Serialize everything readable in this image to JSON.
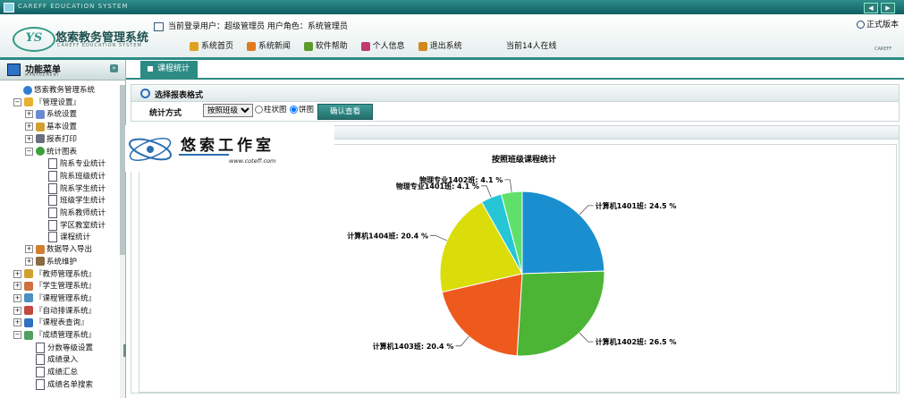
{
  "window": {
    "title": "CAREFF EDUCATION SYSTEM"
  },
  "header": {
    "logo_mark": "YS",
    "app_name": "悠索教务管理系统",
    "app_name_en": "CAREFF EDUCATION SYSTEM",
    "current_user_text": "当前登录用户：超级管理员 用户角色：系统管理员",
    "nav": [
      {
        "label": "系统首页",
        "color": "#e0a020"
      },
      {
        "label": "系统新闻",
        "color": "#e07a20"
      },
      {
        "label": "软件帮助",
        "color": "#5c9a2c"
      },
      {
        "label": "个人信息",
        "color": "#c03a70"
      },
      {
        "label": "退出系统",
        "color": "#d08a20"
      }
    ],
    "online_text": "当前14人在线",
    "version": "正式版本",
    "brand_small": "CAREFF"
  },
  "sidebar": {
    "title": "功能菜单",
    "subtitle": "MANAGEMENT",
    "tree": [
      {
        "label": "悠索教务管理系统",
        "level": 0,
        "pm": "",
        "icon": "globe-icon",
        "color": "#2f7fd0"
      },
      {
        "label": "『管理设置』",
        "level": 1,
        "pm": "−",
        "icon": "folder-icon",
        "color": "#e8b030"
      },
      {
        "label": "系统设置",
        "level": 2,
        "pm": "+",
        "icon": "settings-icon",
        "color": "#6a8ad0"
      },
      {
        "label": "基本设置",
        "level": 2,
        "pm": "+",
        "icon": "key-icon",
        "color": "#d0a030"
      },
      {
        "label": "报表打印",
        "level": 2,
        "pm": "+",
        "icon": "printer-icon",
        "color": "#6a7080"
      },
      {
        "label": "统计图表",
        "level": 2,
        "pm": "−",
        "icon": "pie-chart-icon",
        "color": "#3aa03a"
      },
      {
        "label": "院系专业统计",
        "level": 3,
        "pm": "",
        "icon": "document-icon",
        "color": ""
      },
      {
        "label": "院系班级统计",
        "level": 3,
        "pm": "",
        "icon": "document-icon",
        "color": ""
      },
      {
        "label": "院系学生统计",
        "level": 3,
        "pm": "",
        "icon": "document-icon",
        "color": ""
      },
      {
        "label": "班级学生统计",
        "level": 3,
        "pm": "",
        "icon": "document-icon",
        "color": ""
      },
      {
        "label": "院系教师统计",
        "level": 3,
        "pm": "",
        "icon": "document-icon",
        "color": ""
      },
      {
        "label": "学区教室统计",
        "level": 3,
        "pm": "",
        "icon": "document-icon",
        "color": ""
      },
      {
        "label": "课程统计",
        "level": 3,
        "pm": "",
        "icon": "document-icon",
        "color": ""
      },
      {
        "label": "数据导入导出",
        "level": 2,
        "pm": "+",
        "icon": "data-transfer-icon",
        "color": "#d08030"
      },
      {
        "label": "系统维护",
        "level": 2,
        "pm": "+",
        "icon": "maintenance-icon",
        "color": "#8a6a40"
      },
      {
        "label": "『教师管理系统』",
        "level": 1,
        "pm": "+",
        "icon": "teacher-icon",
        "color": "#d0a030"
      },
      {
        "label": "『学生管理系统』",
        "level": 1,
        "pm": "+",
        "icon": "student-icon",
        "color": "#d07040"
      },
      {
        "label": "『课程管理系统』",
        "level": 1,
        "pm": "+",
        "icon": "course-icon",
        "color": "#4a90c0"
      },
      {
        "label": "『自动排课系统』",
        "level": 1,
        "pm": "+",
        "icon": "schedule-icon",
        "color": "#c04a40"
      },
      {
        "label": "『课程表查询』",
        "level": 1,
        "pm": "+",
        "icon": "search-icon",
        "color": "#3070c0"
      },
      {
        "label": "『成绩管理系统』",
        "level": 1,
        "pm": "−",
        "icon": "grades-icon",
        "color": "#50a060"
      },
      {
        "label": "分数等级设置",
        "level": 2,
        "pm": "",
        "icon": "document-icon",
        "color": ""
      },
      {
        "label": "成绩录入",
        "level": 2,
        "pm": "",
        "icon": "document-icon",
        "color": ""
      },
      {
        "label": "成绩汇总",
        "level": 2,
        "pm": "",
        "icon": "document-icon",
        "color": ""
      },
      {
        "label": "成绩名单搜索",
        "level": 2,
        "pm": "",
        "icon": "document-icon",
        "color": ""
      }
    ]
  },
  "tabs": [
    {
      "label": "课程统计"
    }
  ],
  "report_panel": {
    "title": "选择报表格式",
    "stat_label": "统计方式",
    "select_value": "按照班级",
    "radio_bar": "柱状图",
    "radio_pie": "饼图",
    "confirm": "确认查看"
  },
  "watermark": {
    "title": "悠索工作室",
    "url": "www.coteff.com"
  },
  "chart_data": {
    "type": "pie",
    "title": "按照班级课程统计",
    "slices": [
      {
        "label": "计算机1401班: 24.5 %",
        "value": 24.5,
        "color": "#1a8fd0"
      },
      {
        "label": "计算机1402班: 26.5 %",
        "value": 26.5,
        "color": "#4cb536"
      },
      {
        "label": "计算机1403班: 20.4 %",
        "value": 20.4,
        "color": "#ee5a1e"
      },
      {
        "label": "计算机1404班: 20.4 %",
        "value": 20.4,
        "color": "#dbdd0a"
      },
      {
        "label": "物理专业1401班: 4.1 %",
        "value": 4.1,
        "color": "#26c6d6"
      },
      {
        "label": "物理专业1402班: 4.1 %",
        "value": 4.1,
        "color": "#5ee06a"
      }
    ]
  }
}
